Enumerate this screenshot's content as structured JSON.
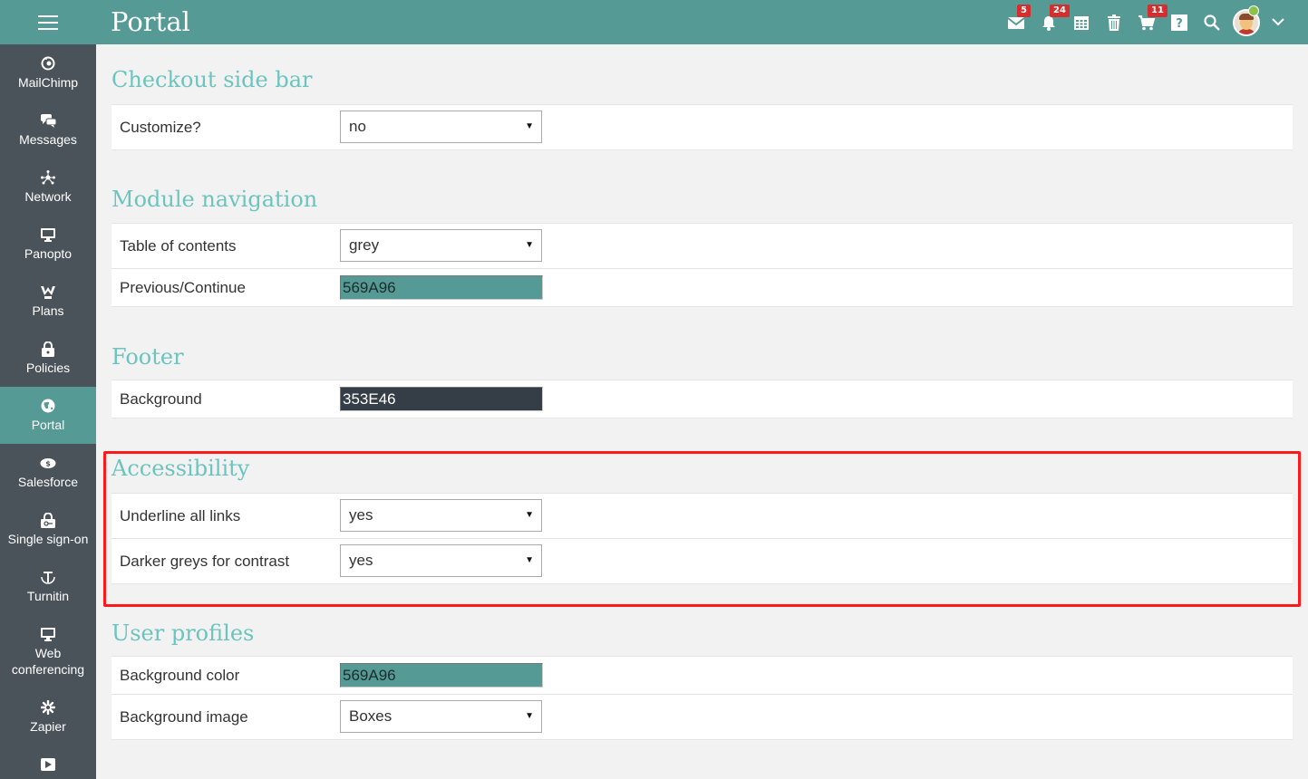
{
  "app": {
    "title": "Portal"
  },
  "topbar": {
    "mail_badge": "5",
    "notifications_badge": "24",
    "cart_badge": "11"
  },
  "sidebar": {
    "items": [
      {
        "label": "MailChimp",
        "icon": "mailchimp-icon"
      },
      {
        "label": "Messages",
        "icon": "chat-icon"
      },
      {
        "label": "Network",
        "icon": "network-icon"
      },
      {
        "label": "Panopto",
        "icon": "monitor-icon"
      },
      {
        "label": "Plans",
        "icon": "plans-icon"
      },
      {
        "label": "Policies",
        "icon": "lock-icon"
      },
      {
        "label": "Portal",
        "icon": "globe-icon",
        "active": true
      },
      {
        "label": "Salesforce",
        "icon": "salesforce-icon"
      },
      {
        "label": "Single sign-on",
        "icon": "sso-lock-icon"
      },
      {
        "label": "Turnitin",
        "icon": "turnitin-icon"
      },
      {
        "label": "Web conferencing",
        "icon": "web-conferencing-icon"
      },
      {
        "label": "Zapier",
        "icon": "zapier-icon"
      },
      {
        "label": "",
        "icon": "video-icon"
      }
    ]
  },
  "sections": {
    "checkout": {
      "title": "Checkout side bar",
      "customize_label": "Customize?",
      "customize_value": "no"
    },
    "module_nav": {
      "title": "Module navigation",
      "toc_label": "Table of contents",
      "toc_value": "grey",
      "prev_label": "Previous/Continue",
      "prev_value": "569A96"
    },
    "footer": {
      "title": "Footer",
      "bg_label": "Background",
      "bg_value": "353E46"
    },
    "accessibility": {
      "title": "Accessibility",
      "underline_label": "Underline all links",
      "underline_value": "yes",
      "darker_label": "Darker greys for contrast",
      "darker_value": "yes"
    },
    "user_profiles": {
      "title": "User profiles",
      "bg_color_label": "Background color",
      "bg_color_value": "569A96",
      "bg_image_label": "Background image",
      "bg_image_value": "Boxes"
    }
  },
  "colors": {
    "accent": "#559A95",
    "sidebar": "#4b535a",
    "heading": "#6cc4be",
    "teal_swatch": "#569A96",
    "dark_swatch": "#353E46",
    "highlight": "#ff1a1a"
  }
}
